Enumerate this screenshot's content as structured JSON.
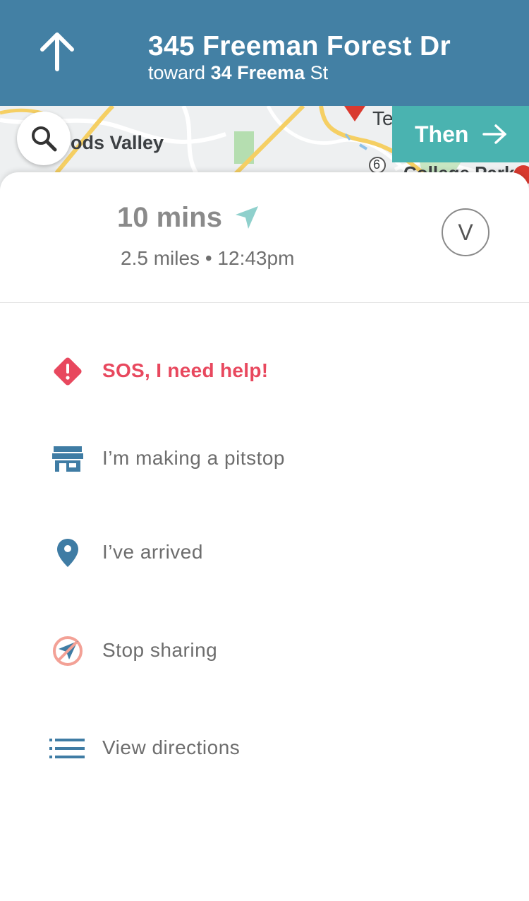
{
  "navigation": {
    "street": "345 Freeman Forest Dr",
    "toward_prefix": "toward",
    "toward_street_bold": "34 Freema",
    "toward_street_suffix": "St",
    "maneuver_icon": "arrow-up-icon"
  },
  "map": {
    "labels": [
      "ods Valley",
      "Te",
      "6",
      "College Park"
    ],
    "search_icon": "search-icon"
  },
  "then_button": {
    "label": "Then",
    "icon": "arrow-right-icon"
  },
  "trip": {
    "eta": "10 mins",
    "distance": "2.5 miles",
    "separator": "•",
    "arrival_time": "12:43pm",
    "avatar_initial": "V"
  },
  "actions": [
    {
      "label": "SOS, I need help!",
      "icon": "sos-alert-icon"
    },
    {
      "label": "I’m making a pitstop",
      "icon": "store-icon"
    },
    {
      "label": "I’ve arrived",
      "icon": "location-pin-icon"
    },
    {
      "label": "Stop sharing",
      "icon": "stop-sharing-icon"
    },
    {
      "label": "View directions",
      "icon": "list-icon"
    }
  ],
  "colors": {
    "header": "#4380a4",
    "then_button": "#4ab3b0",
    "sos": "#e8485e",
    "icon_blue": "#3f7ca4",
    "eta_icon": "#8fd0cc"
  }
}
